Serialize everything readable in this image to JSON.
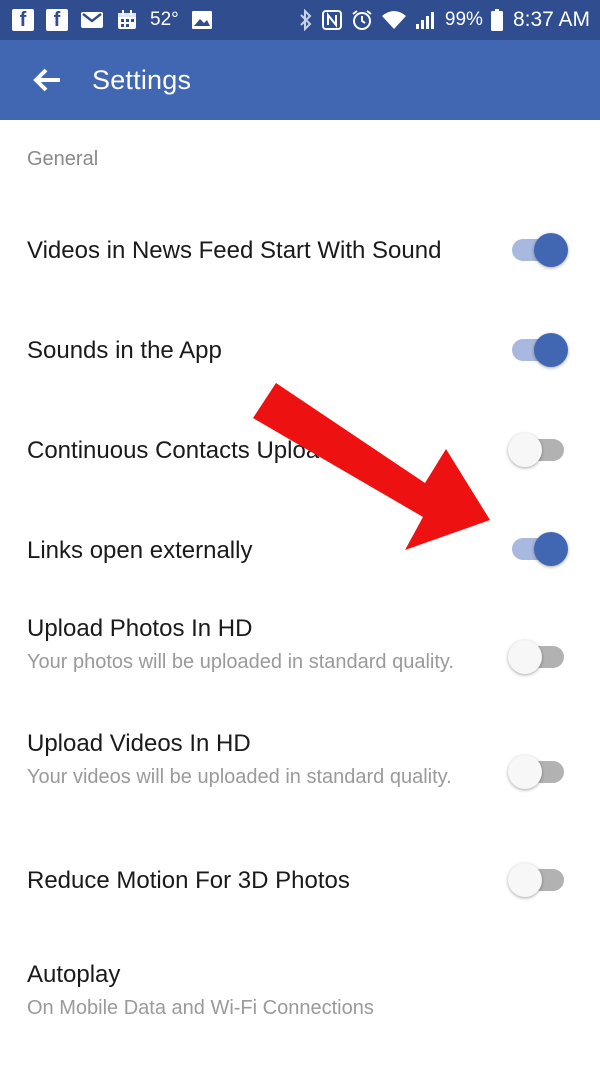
{
  "status_bar": {
    "temperature": "52°",
    "battery": "99%",
    "time": "8:37 AM",
    "icons": [
      "facebook-icon",
      "facebook-icon",
      "gmail-icon",
      "calendar-icon",
      "weather-text",
      "image-icon",
      "bluetooth-icon",
      "nfc-icon",
      "alarm-icon",
      "wifi-icon",
      "signal-icon",
      "battery-icon"
    ]
  },
  "appbar": {
    "title": "Settings",
    "color": "#4267b2"
  },
  "section": {
    "header": "General"
  },
  "settings": [
    {
      "title": "Videos in News Feed Start With Sound",
      "subtitle": "",
      "toggle": "on"
    },
    {
      "title": "Sounds in the App",
      "subtitle": "",
      "toggle": "on"
    },
    {
      "title": "Continuous Contacts Upload",
      "subtitle": "",
      "toggle": "off"
    },
    {
      "title": "Links open externally",
      "subtitle": "",
      "toggle": "on"
    },
    {
      "title": "Upload Photos In HD",
      "subtitle": "Your photos will be uploaded in standard quality.",
      "toggle": "off"
    },
    {
      "title": "Upload Videos In HD",
      "subtitle": "Your videos will be uploaded in standard quality.",
      "toggle": "off"
    },
    {
      "title": "Reduce Motion For 3D Photos",
      "subtitle": "",
      "toggle": "off"
    },
    {
      "title": "Autoplay",
      "subtitle": "On Mobile Data and Wi-Fi Connections",
      "toggle": null
    }
  ],
  "annotation": {
    "shape": "red-arrow",
    "color": "#ee1111"
  }
}
